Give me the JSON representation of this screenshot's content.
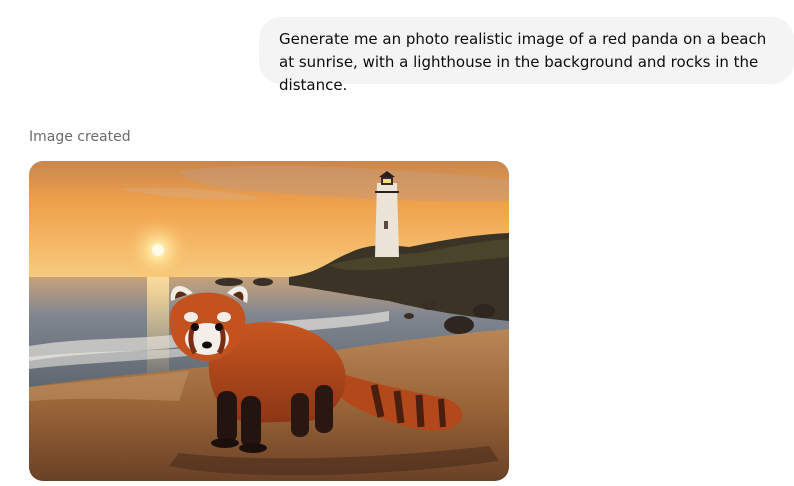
{
  "conversation": {
    "user_message": "Generate me an photo realistic image of a red panda on a beach at sunrise, with a lighthouse in the background and rocks in the distance.",
    "assistant_status": "Image created"
  },
  "image": {
    "subject": "red panda on a beach at sunrise, lighthouse and rocks",
    "colors": {
      "sky_top": "#f2a24a",
      "sky_horizon": "#f7c878",
      "sun": "#fff3c4",
      "sea": "#6f7f8a",
      "sand": "#a06a3a",
      "panda_fur": "#b0481c",
      "panda_dark": "#241410",
      "lighthouse": "#eee7dc"
    }
  }
}
